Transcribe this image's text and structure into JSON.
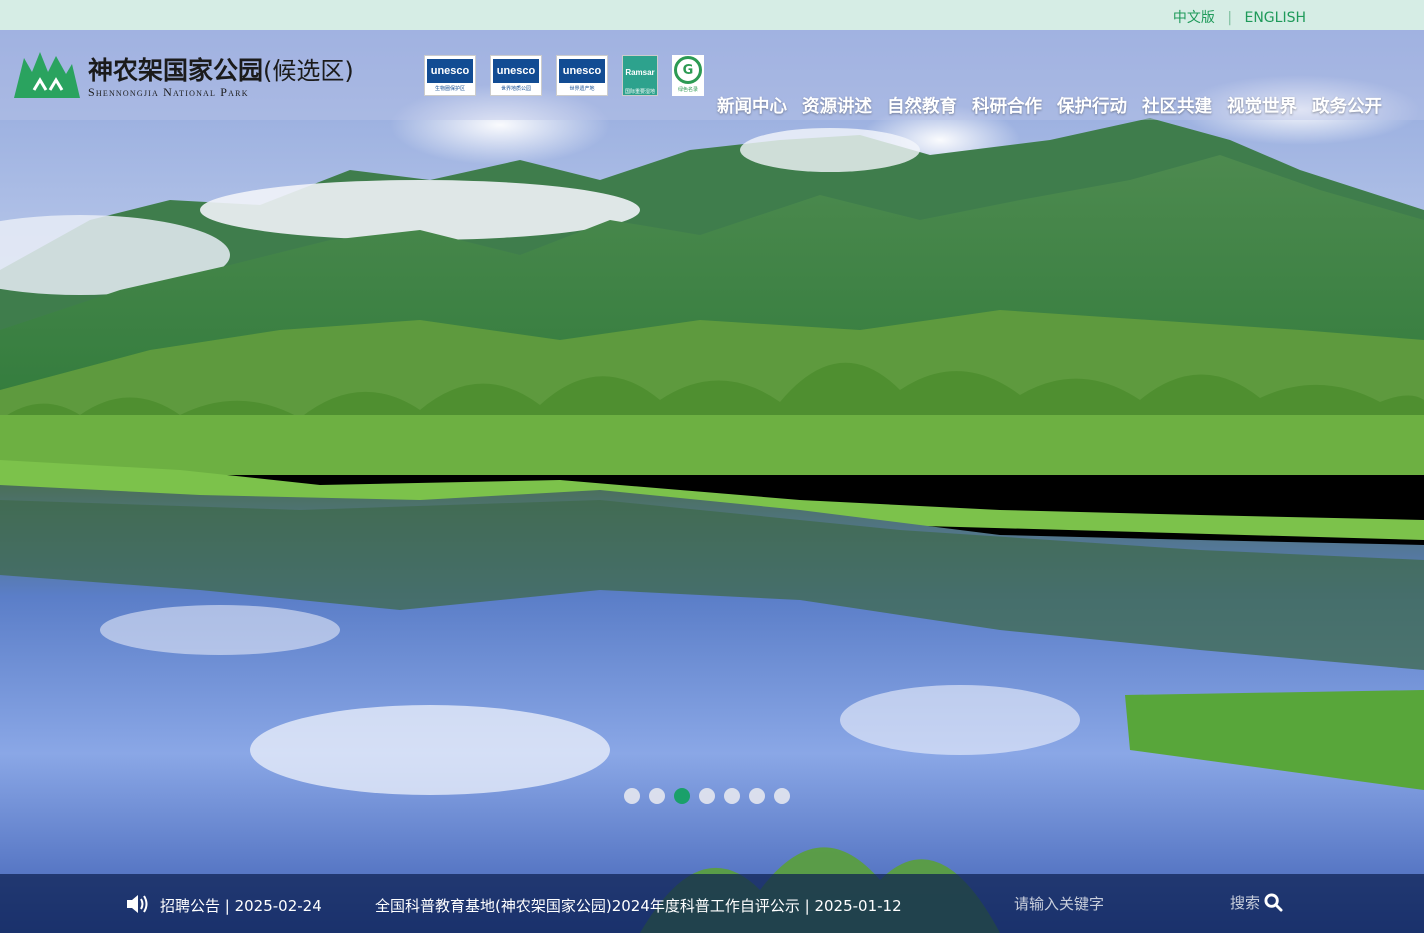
{
  "language_bar": {
    "chinese": "中文版",
    "separator": "|",
    "english": "ENGLISH"
  },
  "logo": {
    "name_cn": "神农架国家公园",
    "name_suffix": "(候选区)",
    "name_en": "Shennongjia National Park"
  },
  "badges": [
    {
      "icon": "unesco-biosphere-icon",
      "label": "unesco",
      "caption": "生物圈保护区"
    },
    {
      "icon": "unesco-geopark-icon",
      "label": "unesco",
      "caption": "世界地质公园"
    },
    {
      "icon": "unesco-heritage-icon",
      "label": "unesco",
      "caption": "世界遗产地"
    },
    {
      "icon": "ramsar-icon",
      "label": "Ramsar",
      "caption": "国际重要湿地"
    },
    {
      "icon": "green-list-icon",
      "label": "G",
      "caption": "绿色名录"
    }
  ],
  "nav": [
    "新闻中心",
    "资源讲述",
    "自然教育",
    "科研合作",
    "保护行动",
    "社区共建",
    "视觉世界",
    "政务公开"
  ],
  "slider": {
    "count": 7,
    "active_index": 2
  },
  "notices": [
    {
      "text": "招聘公告 | 2025-02-24"
    },
    {
      "text": "全国科普教育基地(神农架国家公园)2024年度科普工作自评公示 | 2025-01-12"
    }
  ],
  "search": {
    "placeholder": "请输入关键字",
    "button_label": "搜索"
  },
  "colors": {
    "accent_green": "#1aa06a",
    "lang_bar_bg": "#d6ede5",
    "bottom_bar": "#0c2050"
  }
}
